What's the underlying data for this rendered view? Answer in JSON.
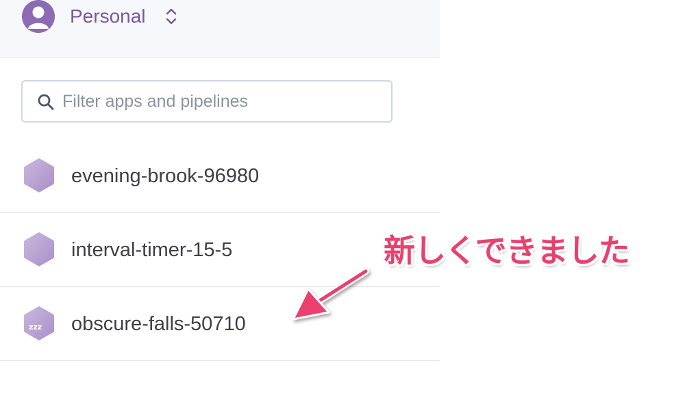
{
  "account": {
    "name": "Personal",
    "avatar_icon": "user-avatar-icon",
    "switch_icon": "chevron-up-down-icon"
  },
  "search": {
    "placeholder": "Filter apps and pipelines",
    "value": "",
    "icon": "search-icon"
  },
  "apps": [
    {
      "name": "evening-brook-96980",
      "icon": "hexagon-app-icon",
      "sleeping": false
    },
    {
      "name": "interval-timer-15-5",
      "icon": "hexagon-app-icon",
      "sleeping": false
    },
    {
      "name": "obscure-falls-50710",
      "icon": "hexagon-sleeping-icon",
      "sleeping": true,
      "icon_text": "zzz"
    }
  ],
  "annotation": {
    "text": "新しくできました",
    "color": "#e9416d"
  },
  "colors": {
    "brand_purple": "#79589f",
    "hex_light": "#c8b6de",
    "hex_dark": "#a991c9",
    "header_bg": "#f7f8fb",
    "divider": "#e3e6ee"
  }
}
